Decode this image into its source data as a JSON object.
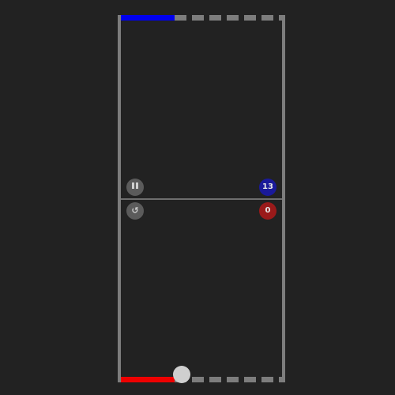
{
  "scores": {
    "blue": "13",
    "red": "0"
  },
  "colors": {
    "background": "#222222",
    "wall": "#7d7d7d",
    "blue_paddle": "#0000ee",
    "red_paddle": "#ee0000",
    "blue_score_bg": "#1a1a9a",
    "red_score_bg": "#9a1a1a",
    "ball": "#cfcfcf",
    "control_bg": "#5b5b5b"
  },
  "controls": {
    "pause_icon": "pause-icon",
    "restart_icon": "restart-icon",
    "restart_glyph": "↺"
  }
}
